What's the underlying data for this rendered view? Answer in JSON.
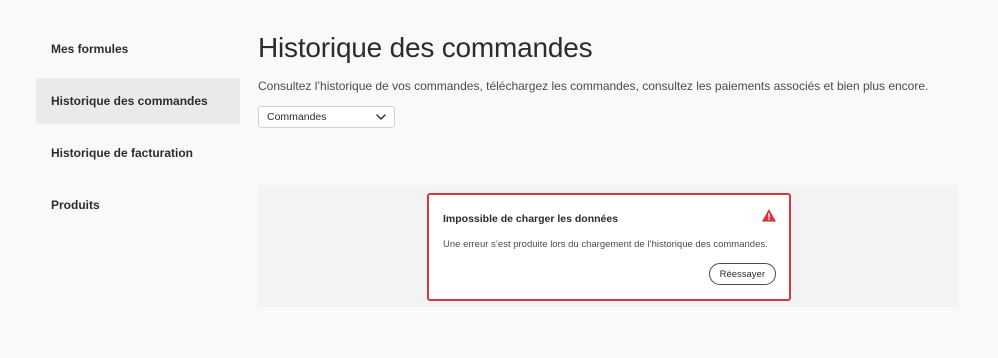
{
  "sidebar": {
    "items": [
      {
        "label": "Mes formules",
        "active": false
      },
      {
        "label": "Historique des commandes",
        "active": true
      },
      {
        "label": "Historique de facturation",
        "active": false
      },
      {
        "label": "Produits",
        "active": false
      }
    ]
  },
  "main": {
    "title": "Historique des commandes",
    "description": "Consultez l’historique de vos commandes, téléchargez les commandes, consultez les paiements associés et bien plus encore.",
    "picker": {
      "selected": "Commandes",
      "icon": "chevron-down-icon"
    }
  },
  "error": {
    "title": "Impossible de charger les données",
    "message": "Une erreur s’est produite lors du chargement de l’historique des commandes.",
    "retry_label": "Réessayer",
    "icon": "alert-icon",
    "color": "#d7373f"
  }
}
